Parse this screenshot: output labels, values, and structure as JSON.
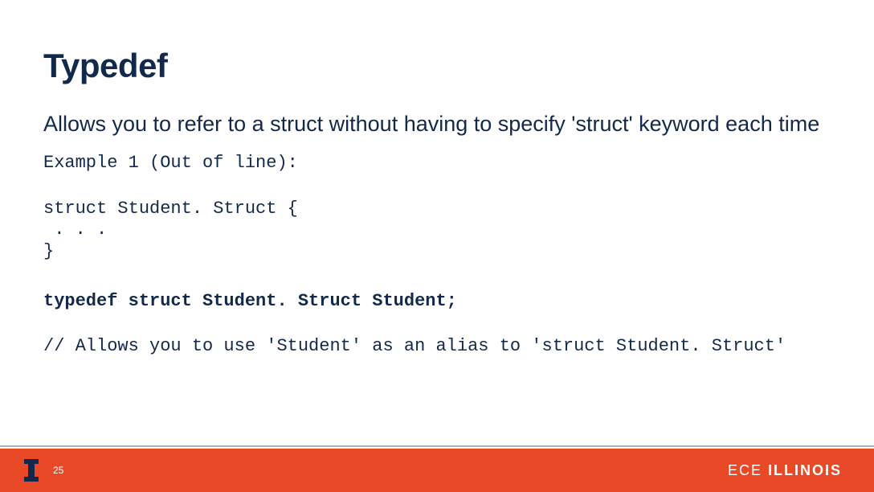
{
  "title": "Typedef",
  "description": "Allows you to refer to a struct without having to specify 'struct' keyword each time",
  "example_label": "Example 1 (Out of line):",
  "code": {
    "line1": "struct Student. Struct {",
    "line2": " . . .",
    "line3": "}",
    "typedef_line": "typedef struct Student. Struct Student;",
    "comment": "// Allows you to use 'Student' as an alias to 'struct Student. Struct'"
  },
  "footer": {
    "page_number": "25",
    "brand_prefix": "ECE ",
    "brand_bold": "ILLINOIS"
  }
}
